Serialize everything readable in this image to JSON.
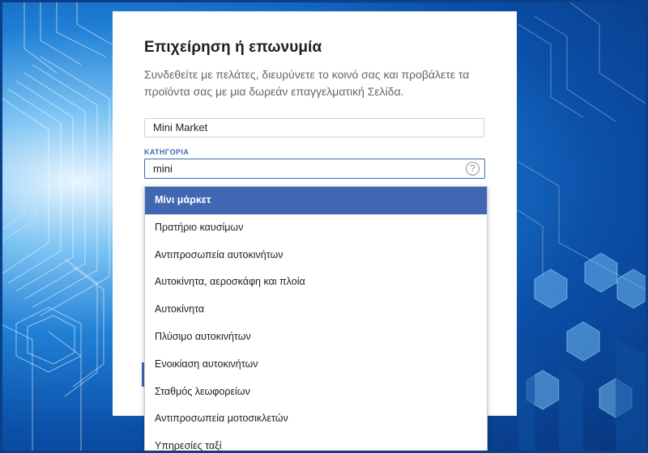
{
  "form": {
    "title": "Επιχείρηση ή επωνυμία",
    "description": "Συνδεθείτε με πελάτες, διευρύνετε το κοινό σας και προβάλετε τα προϊόντα σας με μια δωρεάν επαγγελματική Σελίδα.",
    "name_value": "Mini Market",
    "category_label": "ΚΑΤΗΓΟΡΙΑ",
    "category_value": "mini",
    "help_icon": "question-circle-icon",
    "help_glyph": "?"
  },
  "dropdown": {
    "items": [
      {
        "label": "Μίνι μάρκετ",
        "selected": true
      },
      {
        "label": "Πρατήριο καυσίμων"
      },
      {
        "label": "Αντιπροσωπεία αυτοκινήτων"
      },
      {
        "label": "Αυτοκίνητα, αεροσκάφη και πλοία"
      },
      {
        "label": "Αυτοκίνητα"
      },
      {
        "label": "Πλύσιμο αυτοκινήτων"
      },
      {
        "label": "Ενοικίαση αυτοκινήτων"
      },
      {
        "label": "Σταθμός λεωφορείων"
      },
      {
        "label": "Αντιπροσωπεία μοτοσικλετών"
      },
      {
        "label": "Υπηρεσίες ταξί"
      }
    ]
  },
  "colors": {
    "accent": "#4267b2",
    "background_blue": "#1f7fd4",
    "text_primary": "#1c1e21",
    "text_secondary": "#606770"
  }
}
